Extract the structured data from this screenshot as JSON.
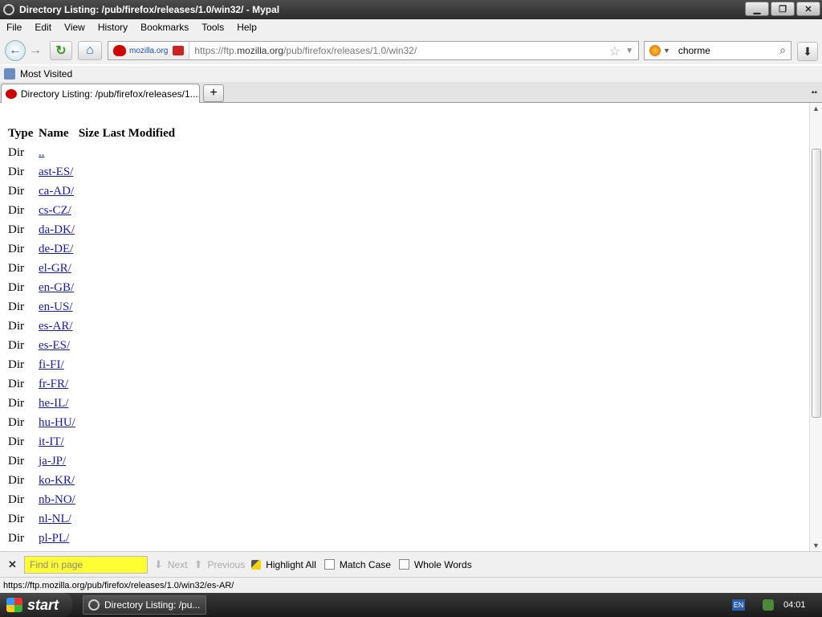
{
  "window": {
    "title": "Directory Listing: /pub/firefox/releases/1.0/win32/ - Mypal",
    "minimize": "▁",
    "maximize": "❐",
    "close": "✕"
  },
  "menu": [
    "File",
    "Edit",
    "View",
    "History",
    "Bookmarks",
    "Tools",
    "Help"
  ],
  "nav": {
    "back_glyph": "←",
    "forward_glyph": "→",
    "reload_glyph": "↻",
    "home_glyph": "⌂",
    "identity_label": "mozilla.org",
    "url_prefix": "https://ftp.",
    "url_domain": "mozilla.org",
    "url_path": "/pub/firefox/releases/1.0/win32/",
    "star_glyph": "☆",
    "search_value": "chorme",
    "search_glyph": "⌕",
    "download_glyph": "⬇"
  },
  "bookmarks": {
    "most_visited": "Most Visited"
  },
  "tabs": [
    {
      "label": "Directory Listing: /pub/firefox/releases/1...."
    }
  ],
  "newtab_glyph": "+",
  "listing": {
    "headers": {
      "type": "Type",
      "name": "Name",
      "size": "Size",
      "modified": "Last Modified"
    },
    "rows": [
      {
        "type": "Dir",
        "name": ".."
      },
      {
        "type": "Dir",
        "name": "ast-ES/"
      },
      {
        "type": "Dir",
        "name": "ca-AD/"
      },
      {
        "type": "Dir",
        "name": "cs-CZ/"
      },
      {
        "type": "Dir",
        "name": "da-DK/"
      },
      {
        "type": "Dir",
        "name": "de-DE/"
      },
      {
        "type": "Dir",
        "name": "el-GR/"
      },
      {
        "type": "Dir",
        "name": "en-GB/"
      },
      {
        "type": "Dir",
        "name": "en-US/"
      },
      {
        "type": "Dir",
        "name": "es-AR/"
      },
      {
        "type": "Dir",
        "name": "es-ES/"
      },
      {
        "type": "Dir",
        "name": "fi-FI/"
      },
      {
        "type": "Dir",
        "name": "fr-FR/"
      },
      {
        "type": "Dir",
        "name": "he-IL/"
      },
      {
        "type": "Dir",
        "name": "hu-HU/"
      },
      {
        "type": "Dir",
        "name": "it-IT/"
      },
      {
        "type": "Dir",
        "name": "ja-JP/"
      },
      {
        "type": "Dir",
        "name": "ko-KR/"
      },
      {
        "type": "Dir",
        "name": "nb-NO/"
      },
      {
        "type": "Dir",
        "name": "nl-NL/"
      },
      {
        "type": "Dir",
        "name": "pl-PL/"
      }
    ]
  },
  "findbar": {
    "close_glyph": "✕",
    "placeholder": "Find in page",
    "next": "Next",
    "next_glyph": "⬇",
    "previous": "Previous",
    "previous_glyph": "⬆",
    "highlight_all": "Highlight All",
    "match_case": "Match Case",
    "whole_words": "Whole Words"
  },
  "status": {
    "text": "https://ftp.mozilla.org/pub/firefox/releases/1.0/win32/es-AR/"
  },
  "taskbar": {
    "start": "start",
    "task_label": "Directory Listing: /pu...",
    "lang": "EN",
    "clock": "04:01"
  },
  "colors": {
    "link": "#1a1a9a",
    "find_input_bg": "#ffff33"
  }
}
